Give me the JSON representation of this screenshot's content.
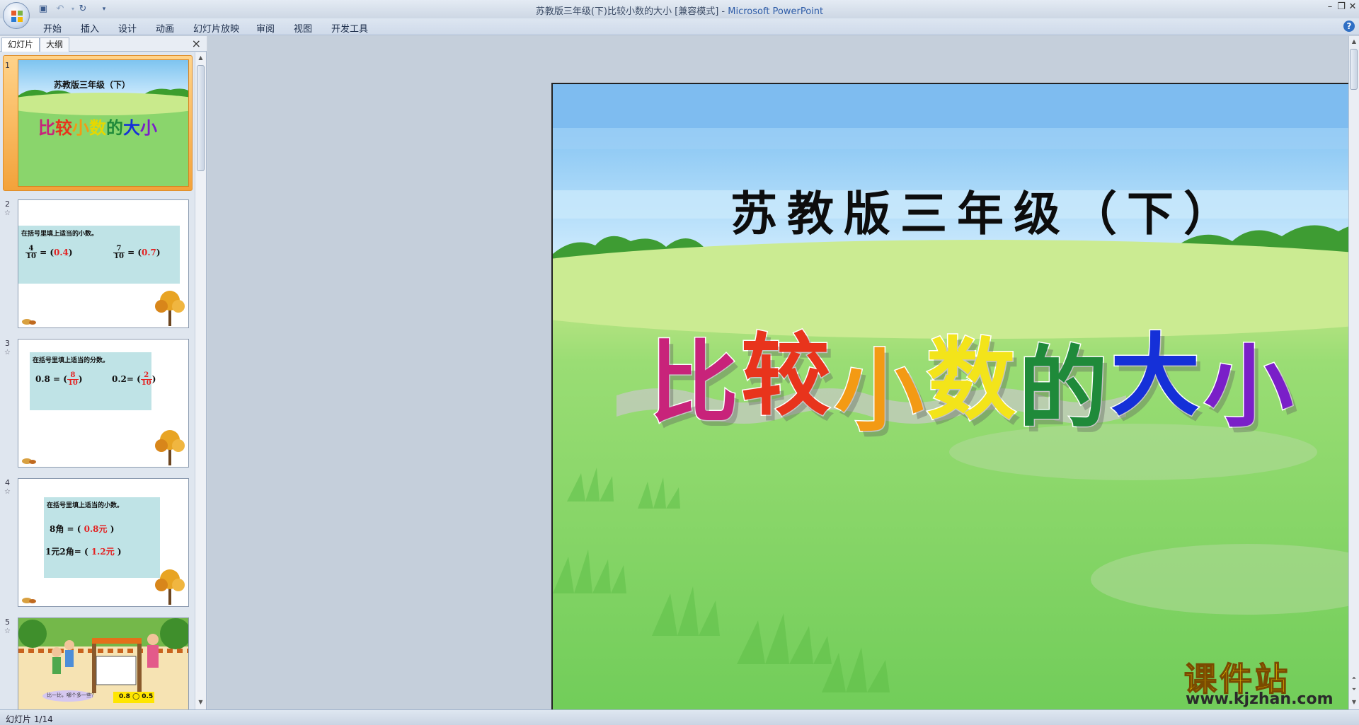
{
  "window": {
    "title_doc": "苏教版三年级(下)比较小数的大小 [兼容模式] - ",
    "title_app": "Microsoft PowerPoint"
  },
  "ribbon": {
    "tabs": [
      "开始",
      "插入",
      "设计",
      "动画",
      "幻灯片放映",
      "审阅",
      "视图",
      "开发工具"
    ]
  },
  "panel": {
    "tab_slides": "幻灯片",
    "tab_outline": "大纲",
    "close": "×"
  },
  "thumbnails": [
    {
      "num": "1",
      "title": "苏教版三年级（下）",
      "subtitle": [
        "比",
        "较",
        "小",
        "数",
        "的",
        "大",
        "小"
      ]
    },
    {
      "num": "2",
      "header": "在括号里填上适当的小数。",
      "eq1_num": "4",
      "eq1_den": "10",
      "eq1_ans": "0.4",
      "eq2_num": "7",
      "eq2_den": "10",
      "eq2_ans": "0.7"
    },
    {
      "num": "3",
      "header": "在括号里填上适当的分数。",
      "eq1_left": "0.8 =",
      "eq1_num": "8",
      "eq1_den": "10",
      "eq2_left": "0.2=",
      "eq2_num": "2",
      "eq2_den": "10"
    },
    {
      "num": "4",
      "header": "在括号里填上适当的小数。",
      "eq1_left": "8角 =",
      "eq1_ans": "0.8元",
      "eq2_left": "1元2角=",
      "eq2_ans": "1.2元"
    },
    {
      "num": "5",
      "bubble": "比一比，哪个多一些？",
      "compare": "0.8 ◯ 0.5"
    }
  ],
  "slide": {
    "title": "苏教版三年级（下）",
    "subtitle_chars": [
      "比",
      "较",
      "小",
      "数",
      "的",
      "大",
      "小"
    ],
    "subtitle_colors": [
      "#c8237a",
      "#e8341c",
      "#f39a14",
      "#f3e41a",
      "#1f8a3a",
      "#1530d8",
      "#7a1fc8"
    ]
  },
  "status": {
    "text": "幻灯片 1/14"
  },
  "watermark": {
    "title": "课件站",
    "url": "www.kjzhan.com"
  }
}
